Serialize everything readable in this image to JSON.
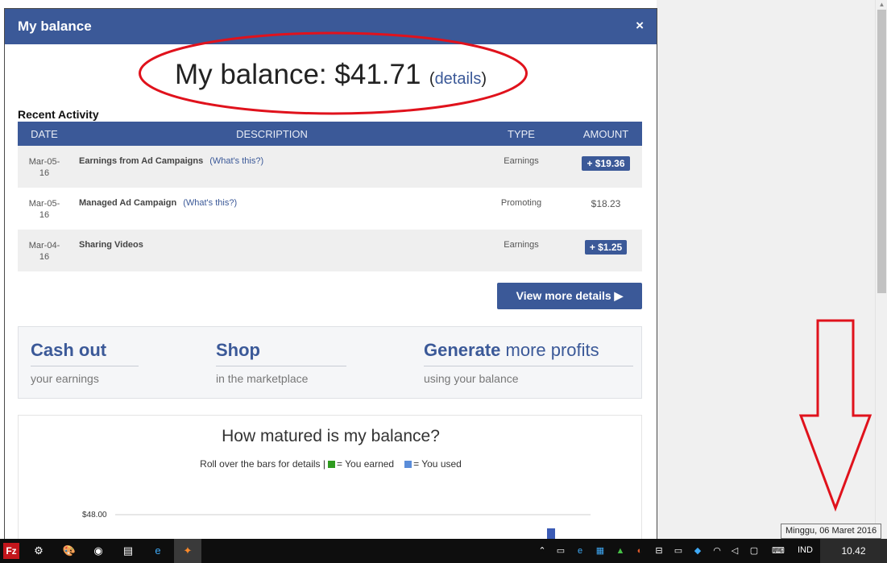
{
  "modal": {
    "title": "My balance",
    "close_glyph": "×",
    "balance_text": "My balance: $41.71",
    "details_link": "details",
    "recent_activity_title": "Recent Activity",
    "table": {
      "headers": [
        "DATE",
        "DESCRIPTION",
        "TYPE",
        "AMOUNT"
      ],
      "rows": [
        {
          "date_line1": "Mar-05-",
          "date_line2": "16",
          "description": "Earnings from Ad Campaigns",
          "help": "(What's this?)",
          "type": "Earnings",
          "amount": "+ $19.36",
          "badge": true
        },
        {
          "date_line1": "Mar-05-",
          "date_line2": "16",
          "description": "Managed Ad Campaign",
          "help": "(What's this?)",
          "type": "Promoting",
          "amount": "$18.23",
          "badge": false
        },
        {
          "date_line1": "Mar-04-",
          "date_line2": "16",
          "description": "Sharing Videos",
          "help": "",
          "type": "Earnings",
          "amount": "+ $1.25",
          "badge": true
        }
      ]
    },
    "view_more_label": "View more details ▶",
    "actions": [
      {
        "title_strong": "Cash out",
        "title_rest": "",
        "subtitle": "your earnings"
      },
      {
        "title_strong": "Shop",
        "title_rest": "",
        "subtitle": "in the marketplace"
      },
      {
        "title_strong": "Generate",
        "title_rest": " more profits",
        "subtitle": "using your balance"
      }
    ],
    "chart": {
      "title": "How matured is my balance?",
      "legend_prefix": "Roll over the bars for details |",
      "legend_earned": "= You earned",
      "legend_used": "= You used",
      "y_tick_label": "$48.00",
      "colors": {
        "earned": "#2e9b1f",
        "used": "#5b8dd9",
        "bar": "#3b5bb5"
      }
    }
  },
  "chart_data": {
    "type": "bar",
    "title": "How matured is my balance?",
    "legend": [
      "You earned",
      "You used"
    ],
    "y_ticks": [
      "$48.00"
    ],
    "note": ""
  },
  "tooltip": "Minggu, 06 Maret 2016",
  "taskbar": {
    "language": "IND",
    "clock": "10.42",
    "icons": [
      "filezilla-icon",
      "tool-icon",
      "paint-icon",
      "paint-bucket-icon",
      "notepad-icon",
      "ie-icon",
      "uc-browser-icon"
    ],
    "tray": [
      "chevron-up-icon",
      "monitor-icon",
      "edge-icon",
      "network-icon",
      "vuze-icon",
      "ccleaner-icon",
      "usb-icon",
      "battery-icon",
      "dropbox-icon",
      "wifi-icon",
      "volume-icon",
      "notification-icon",
      "keyboard-icon"
    ]
  },
  "colors": {
    "brand": "#3b5998",
    "annotation": "#e0121c"
  }
}
